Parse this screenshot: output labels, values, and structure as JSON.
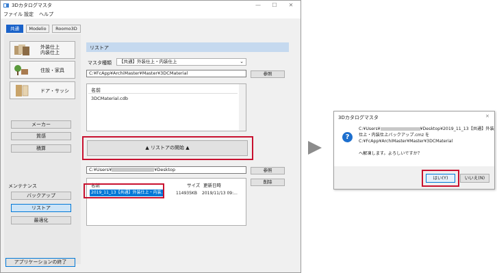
{
  "main_window": {
    "title": "3Dカタログマスタ",
    "menu": [
      "ファイル",
      "設定",
      "ヘルプ"
    ],
    "tabs": [
      "共通",
      "Modelio",
      "Roomo3D"
    ],
    "categories": [
      {
        "label": "外装仕上\n内装仕上"
      },
      {
        "label": "住設・家具"
      },
      {
        "label": "ドア・サッシ"
      }
    ],
    "side_buttons": [
      "メーカー",
      "質感",
      "積算"
    ],
    "maintenance_label": "メンテナンス",
    "maintenance_buttons": [
      "バックアップ",
      "リストア",
      "最適化"
    ],
    "exit_button": "アプリケーションの終了",
    "section_title": "リストア",
    "master_type_label": "マスタ種類",
    "master_type_value": "【共通】外装仕上・内装仕上",
    "master_path": "C:¥FcApp¥ArchiMaster¥Master¥3DCMaterial",
    "browse_label": "参照",
    "file_list_header": "名前",
    "file_list_items": [
      "3DCMaterial.cdb"
    ],
    "restore_start": "▲ リストアの開始 ▲",
    "backup_path_prefix": "C:¥Users¥",
    "backup_path_suffix": "¥Desktop",
    "delete_label": "削除",
    "backup_list": {
      "headers": [
        "名前",
        "サイズ",
        "更新日時"
      ],
      "rows": [
        {
          "name": "2019_11_13【共通】外装仕上・内装...",
          "size": "114935KB",
          "date": "2019/11/13 09:..."
        }
      ]
    }
  },
  "arrow_icon": "right-triangle-arrow-icon",
  "dialog": {
    "title": "3Dカタログマスタ",
    "icon": "question-icon",
    "line1_prefix": "C:¥Users¥",
    "line1_suffix": "¥Desktop¥2019_11_13【共通】外装",
    "line2": "仕上・内装仕上バックアップ.cmz を",
    "line3": "C:¥FcApp¥ArchiMaster¥Master¥3DCMaterial",
    "line4": "へ解凍します。よろしいですか？",
    "yes": "はい(Y)",
    "no": "いいえ(N)"
  },
  "colors": {
    "accent": "#1a62c9",
    "highlight": "#c8102e",
    "section": "#c5d9ef",
    "selection": "#0078d7"
  }
}
